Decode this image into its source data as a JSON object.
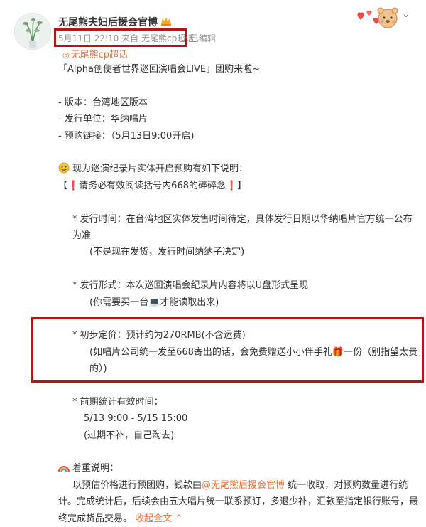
{
  "post": {
    "username": "无尾熊夫妇后援会官博",
    "vip_badge_icon": "vip-crown-icon",
    "timestamp": "5月11日 22:10",
    "source_prefix": "来自",
    "source_name": "无尾熊cp超话",
    "edited": "已编辑",
    "topic": "无尾熊cp超话",
    "collapse_label": "收起全文",
    "mention": "@无尾熊后援会官博",
    "accent_color": "#eb7340",
    "highlight_box_color": "#b01818"
  },
  "content": {
    "title": "「Alpha创使者世界巡回演唱会LIVE」团购来啦~",
    "version": "- 版本：台湾地区版本",
    "publisher": "- 发行单位：华纳唱片",
    "preorder": "- 预购链接：（5月13日9:00开启)",
    "notice_intro": "现为巡演纪录片实体开启预购有如下说明：",
    "must_read": "【❗请务必有效阅读括号内668的碎碎念❗】",
    "release_time_1": "* 发行时间：在台湾地区实体发售时间待定，具体发行日期以华纳唱片官方统一公布为准",
    "release_time_2": "(不是现在发货，发行时间纳纳子决定)",
    "format_1": "* 发行形式：本次巡回演唱会纪录片内容将以U盘形式呈现",
    "format_2": "(你需要买一台💻才能读取出来)",
    "price_1": "* 初步定价：预计约为270RMB(不含运费)",
    "price_2": "(如唱片公司统一发至668寄出的话，会免费赠送小小伴手礼🎁一份（别指望太贵的）)",
    "period_1": "* 前期统计有效时间：",
    "period_2": "5/13 9:00 - 5/15 15:00",
    "period_3": "(过期不补，自己淘去)",
    "focus_title": "着重说明：",
    "focus_body_before": "以预估价格进行预团购，钱款由",
    "focus_body_after": " 统一收取，对预购数量进行统计。完成统计后，后续会由五大唱片统一联系预订，多退少补，汇款至指定银行账号，最终完成货品交易。"
  }
}
